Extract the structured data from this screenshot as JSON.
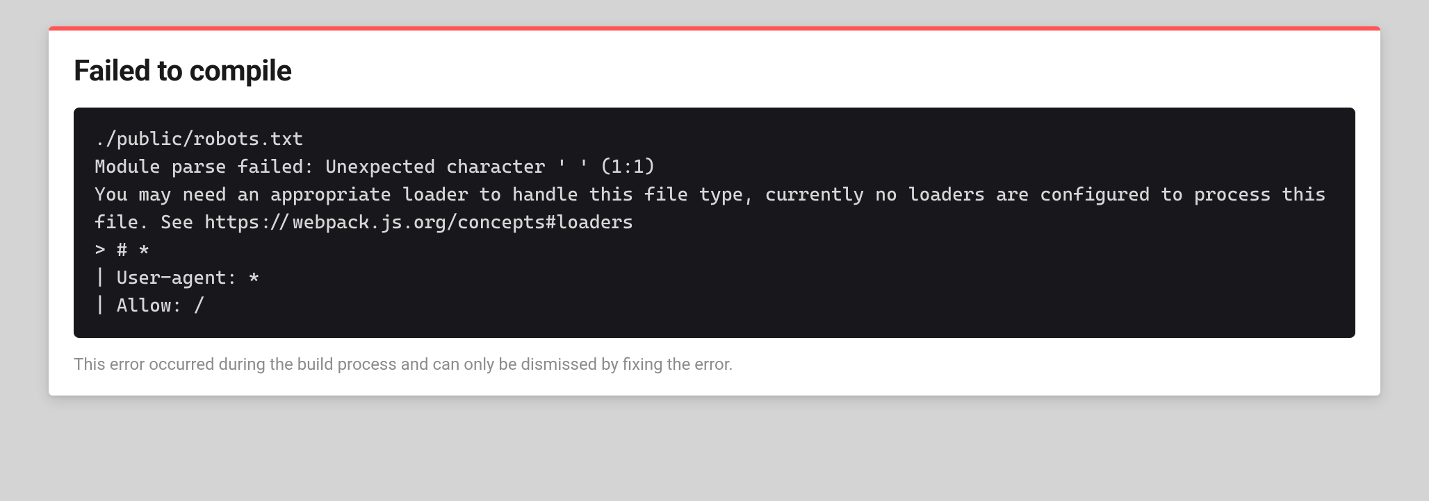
{
  "error": {
    "title": "Failed to compile",
    "message": "./public/robots.txt\nModule parse failed: Unexpected character ' ' (1:1)\nYou may need an appropriate loader to handle this file type, currently no loaders are configured to process this file. See https://webpack.js.org/concepts#loaders\n> # *\n| User-agent: *\n| Allow: /",
    "footer": "This error occurred during the build process and can only be dismissed by fixing the error."
  }
}
